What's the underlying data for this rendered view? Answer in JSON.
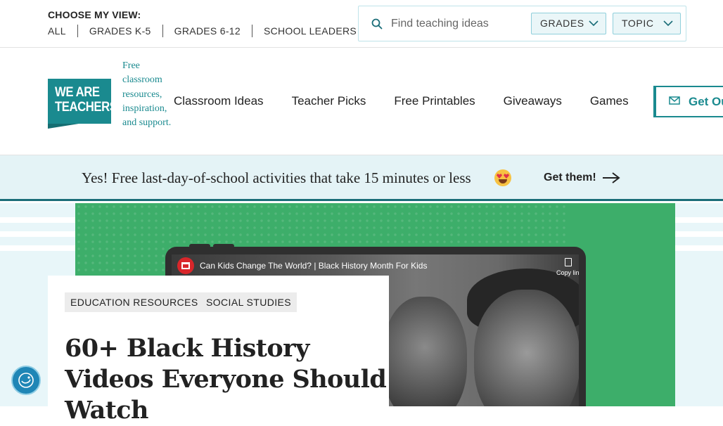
{
  "topbar": {
    "view_heading": "CHOOSE MY VIEW:",
    "view_links": [
      "ALL",
      "GRADES K-5",
      "GRADES 6-12",
      "SCHOOL LEADERS"
    ],
    "search_placeholder": "Find teaching ideas",
    "grades_label": "GRADES",
    "topic_label": "TOPIC"
  },
  "header": {
    "logo_line1": "WE ARE",
    "logo_line2": "TEACHERS",
    "tagline": "Free classroom resources, inspiration, and support.",
    "nav": [
      "Classroom Ideas",
      "Teacher Picks",
      "Free Printables",
      "Giveaways",
      "Games"
    ],
    "cta_label": "Get Ou"
  },
  "banner": {
    "text": "Yes! Free last-day-of-school activities that take 15 minutes or less",
    "cta": "Get them!"
  },
  "video": {
    "title": "Can Kids Change The World? | Black History Month For Kids",
    "copy_label": "Copy link"
  },
  "article": {
    "tags": [
      "EDUCATION RESOURCES",
      "SOCIAL STUDIES"
    ],
    "title": "60+ Black History Videos Everyone Should Watch"
  },
  "colors": {
    "brand_teal": "#1a8a8f",
    "hero_green": "#3dae6a",
    "banner_bg": "#e4f3f6"
  },
  "icons": [
    "search-icon",
    "chevron-down-icon",
    "mail-icon",
    "arrow-right-icon",
    "copy-icon",
    "accessibility-icon"
  ]
}
